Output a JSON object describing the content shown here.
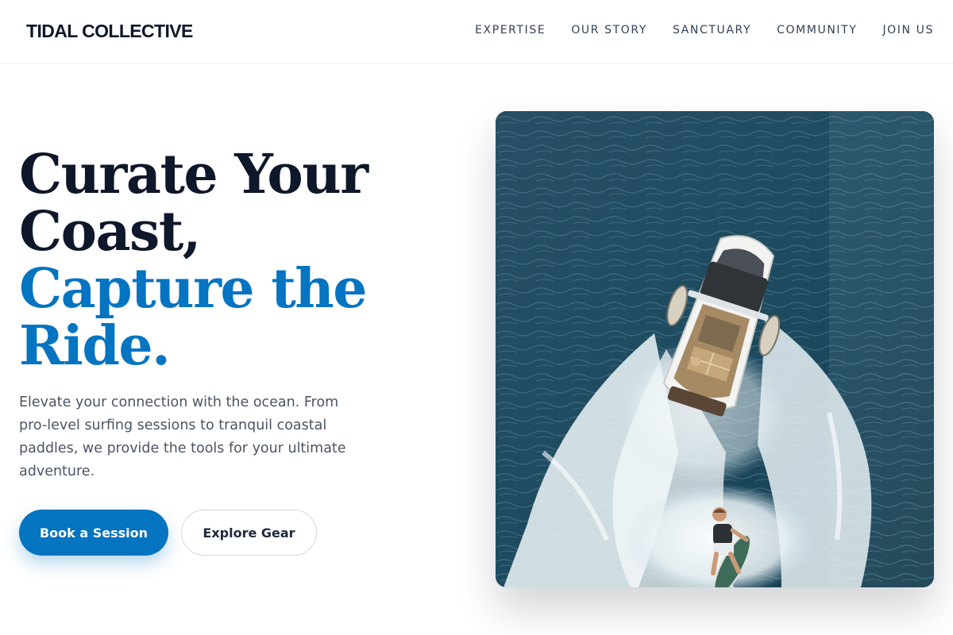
{
  "brand": {
    "name": "TIDAL COLLECTIVE"
  },
  "nav": {
    "items": [
      {
        "label": "EXPERTISE"
      },
      {
        "label": "OUR STORY"
      },
      {
        "label": "SANCTUARY"
      },
      {
        "label": "COMMUNITY"
      },
      {
        "label": "JOIN US"
      }
    ]
  },
  "hero": {
    "headline_dark": [
      "Curate Your",
      "Coast,"
    ],
    "headline_blue": [
      "Capture the",
      "Ride."
    ],
    "description": "Elevate your connection with the ocean. From pro-level surfing sessions to tranquil coastal paddles, we provide the tools for your ultimate adventure.",
    "primary_cta": "Book a Session",
    "secondary_cta": "Explore Gear",
    "image_description": "Aerial view of a wake boat pulling a wakesurfer across the ocean"
  },
  "colors": {
    "accent": "#0574c1",
    "ink": "#0f172a",
    "body_text": "#4b5563"
  }
}
